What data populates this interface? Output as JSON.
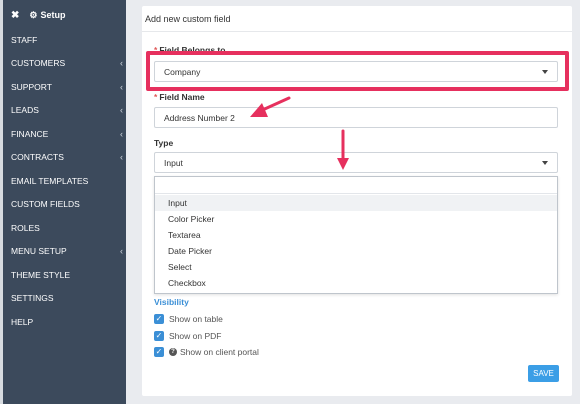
{
  "sidebar": {
    "close_glyph": "✖",
    "gear_glyph": "⚙",
    "setup_label": "Setup",
    "items": [
      {
        "label": "STAFF",
        "chevron": false
      },
      {
        "label": "CUSTOMERS",
        "chevron": true
      },
      {
        "label": "SUPPORT",
        "chevron": true
      },
      {
        "label": "LEADS",
        "chevron": true
      },
      {
        "label": "FINANCE",
        "chevron": true
      },
      {
        "label": "CONTRACTS",
        "chevron": true
      },
      {
        "label": "EMAIL TEMPLATES",
        "chevron": false
      },
      {
        "label": "CUSTOM FIELDS",
        "chevron": false
      },
      {
        "label": "ROLES",
        "chevron": false
      },
      {
        "label": "MENU SETUP",
        "chevron": true
      },
      {
        "label": "THEME STYLE",
        "chevron": false
      },
      {
        "label": "SETTINGS",
        "chevron": false
      },
      {
        "label": "HELP",
        "chevron": false
      }
    ],
    "chevron_glyph": "‹"
  },
  "form": {
    "title": "Add new custom field",
    "required_marker": "*",
    "belongs_label": "Field Belongs to",
    "belongs_value": "Company",
    "name_label": "Field Name",
    "name_value": "Address Number 2",
    "type_label": "Type",
    "type_value": "Input",
    "type_options": [
      "Input",
      "Color Picker",
      "Textarea",
      "Date Picker",
      "Select",
      "Checkbox"
    ],
    "visibility_title": "Visibility",
    "checkbox_glyph": "✓",
    "help_glyph": "?",
    "visibility_options": [
      "Show on table",
      "Show on PDF",
      "Show on client portal"
    ],
    "save_label": "SAVE"
  },
  "colors": {
    "sidebar_bg": "#3c4a5c",
    "highlight": "#e6305e",
    "accent": "#3b8fd6"
  }
}
